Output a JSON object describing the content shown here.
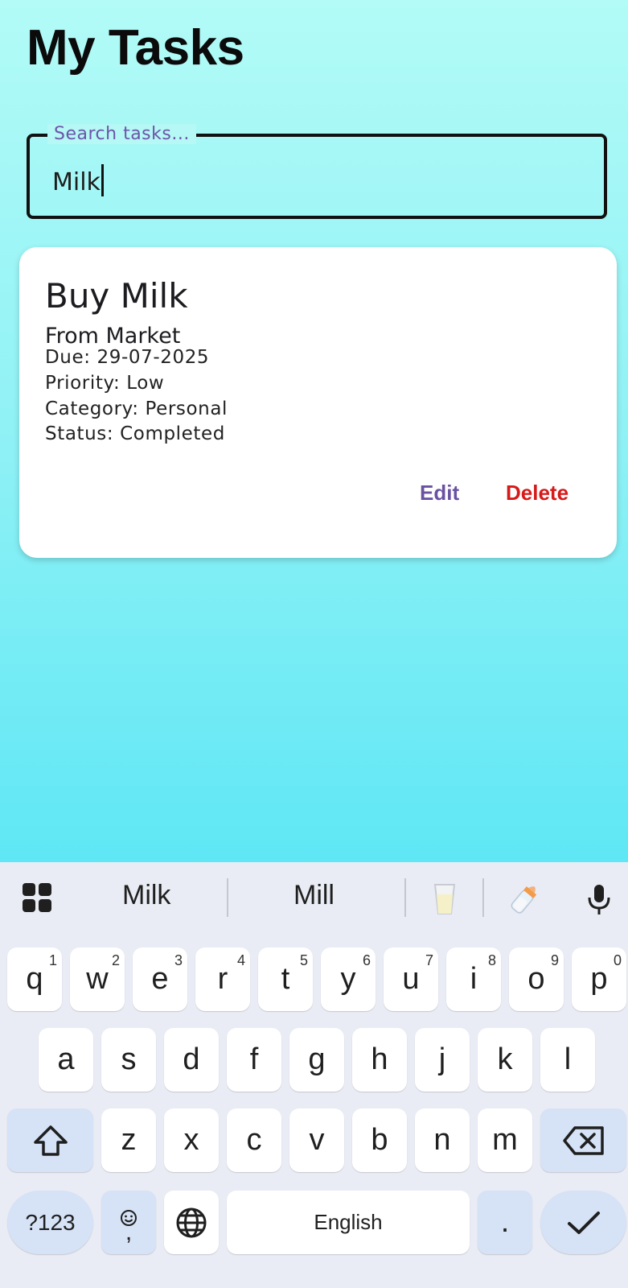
{
  "header": {
    "title": "My Tasks"
  },
  "search": {
    "label": "Search tasks...",
    "value": "Milk"
  },
  "task": {
    "title": "Buy Milk",
    "description": "From Market",
    "due": "Due: 29-07-2025",
    "priority": "Priority: Low",
    "category": "Category: Personal",
    "status": "Status: Completed",
    "edit_label": "Edit",
    "delete_label": "Delete",
    "colors": {
      "edit": "#6a52a3",
      "delete": "#d61a1a"
    }
  },
  "keyboard": {
    "suggestions": [
      "Milk",
      "Mill"
    ],
    "emoji_suggestions": [
      "glass-of-milk-emoji",
      "baby-bottle-emoji"
    ],
    "row1": [
      {
        "k": "q",
        "n": "1"
      },
      {
        "k": "w",
        "n": "2"
      },
      {
        "k": "e",
        "n": "3"
      },
      {
        "k": "r",
        "n": "4"
      },
      {
        "k": "t",
        "n": "5"
      },
      {
        "k": "y",
        "n": "6"
      },
      {
        "k": "u",
        "n": "7"
      },
      {
        "k": "i",
        "n": "8"
      },
      {
        "k": "o",
        "n": "9"
      },
      {
        "k": "p",
        "n": "0"
      }
    ],
    "row2": [
      "a",
      "s",
      "d",
      "f",
      "g",
      "h",
      "j",
      "k",
      "l"
    ],
    "row3": [
      "z",
      "x",
      "c",
      "v",
      "b",
      "n",
      "m"
    ],
    "symbols_label": "?123",
    "space_label": "English",
    "period_label": ".",
    "emoji_comma_label": ","
  }
}
